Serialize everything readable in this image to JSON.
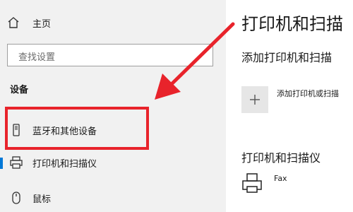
{
  "sidebar": {
    "home_label": "主页",
    "search_placeholder": "查找设置",
    "section_title": "设备",
    "items": [
      {
        "label": "蓝牙和其他设备",
        "icon": "bluetooth-device-icon"
      },
      {
        "label": "打印机和扫描仪",
        "icon": "printer-icon",
        "selected": true
      },
      {
        "label": "鼠标",
        "icon": "mouse-icon"
      }
    ]
  },
  "main": {
    "title": "打印机和扫描",
    "add_section_title": "添加打印机和扫描",
    "add_button_label": "添加打印机或扫描",
    "printers_section_title": "打印机和扫描仪",
    "printers": [
      {
        "name": "Fax",
        "icon": "fax-icon"
      }
    ]
  },
  "annotation": {
    "color": "#e8232b"
  },
  "colors": {
    "accent": "#0078d7",
    "sidebar_bg": "#f1f1f1"
  }
}
